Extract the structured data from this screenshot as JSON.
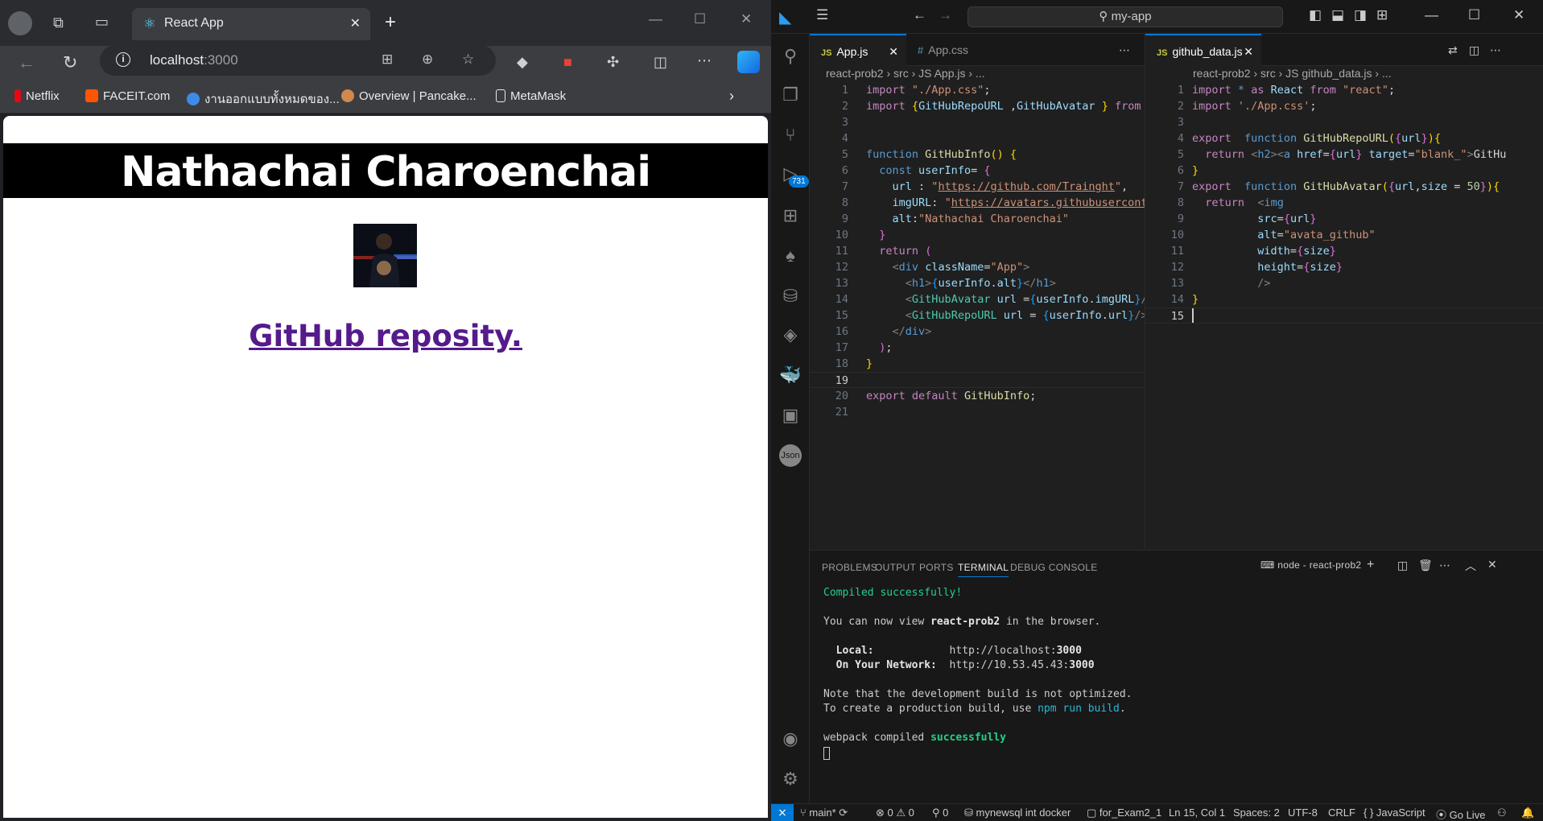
{
  "browser": {
    "tab_title": "React App",
    "url_host": "localhost",
    "url_port": ":3000",
    "bookmarks": [
      "Netflix",
      "FACEIT.com",
      "งานออกแบบทั้งหมดของ...",
      "Overview | Pancake...",
      "MetaMask"
    ]
  },
  "page": {
    "heading": "Nathachai Charoenchai",
    "link_text": "GitHub reposity."
  },
  "vscode": {
    "search": "my-app",
    "left_tabs": [
      "App.js",
      "App.css"
    ],
    "right_tabs": [
      "github_data.js"
    ],
    "left_crumbs": "react-prob2 › src › JS App.js › ...",
    "right_crumbs": "react-prob2 › src › JS github_data.js › ...",
    "activity_badge": "731",
    "panel_tabs": [
      "PROBLEMS",
      "OUTPUT",
      "PORTS",
      "TERMINAL",
      "DEBUG CONSOLE"
    ],
    "terminal_name": "node - react-prob2",
    "terminal": {
      "compiled": "Compiled successfully!",
      "view_pre": "You can now view ",
      "project": "react-prob2",
      "view_post": " in the browser.",
      "local_label": "Local:",
      "local_url": "http://localhost:",
      "local_port": "3000",
      "network_label": "On Your Network:",
      "network_url": "http://10.53.45.43:",
      "network_port": "3000",
      "note1": "Note that the development build is not optimized.",
      "note2_pre": "To create a production build, use ",
      "note2_cmd": "npm run build",
      "note2_post": ".",
      "webpack_pre": "webpack compiled ",
      "webpack_ok": "successfully"
    },
    "status": {
      "branch": "main*",
      "errors": "⊗ 0 ⚠ 0",
      "ports": "0",
      "db": "mynewsql int docker",
      "folder": "for_Exam2_1",
      "position": "Ln 15, Col 1",
      "spaces": "Spaces: 2",
      "encoding": "UTF-8",
      "eol": "CRLF",
      "language": "JavaScript",
      "golive": "Go Live"
    }
  },
  "colors": {
    "accent": "#0078d4",
    "link_visited": "#551a8b",
    "terminal_green": "#23d18b"
  }
}
